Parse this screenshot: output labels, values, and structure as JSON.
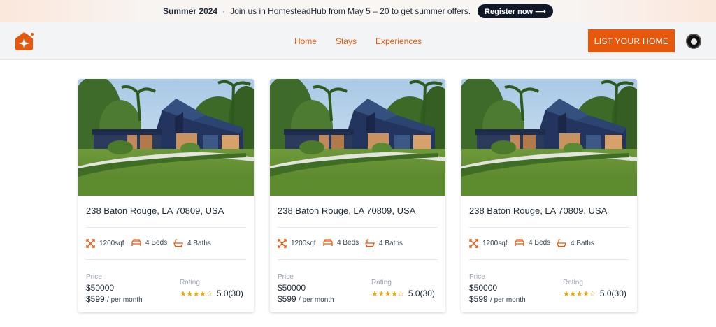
{
  "banner": {
    "season": "Summer 2024",
    "separator": "·",
    "message": "Join us in HomesteadHub from May 5 – 20 to get summer offers.",
    "cta_label": "Register now ⟶"
  },
  "nav": {
    "links": [
      "Home",
      "Stays",
      "Experiences"
    ],
    "cta_label": "LIST YOUR HOME"
  },
  "brand": {
    "accent": "#e8580c",
    "dark": "#111827",
    "star": "#e5a511"
  },
  "icons": {
    "logo": "house-star-icon",
    "area": "area-expand-icon",
    "beds": "bed-icon",
    "baths": "bathtub-icon",
    "star": "star-icon",
    "avatar": "user-avatar"
  },
  "listings": [
    {
      "address": "238 Baton Rouge, LA 70809, USA",
      "area": "1200sqf",
      "beds": "4 Beds",
      "baths": "4 Baths",
      "price_label": "Price",
      "price": "$50000",
      "monthly": "$599",
      "monthly_suffix": "/ per month",
      "rating_label": "Rating",
      "stars_full": 4,
      "stars_total": 5,
      "rating": "5.0(30)"
    },
    {
      "address": "238 Baton Rouge, LA 70809, USA",
      "area": "1200sqf",
      "beds": "4 Beds",
      "baths": "4 Baths",
      "price_label": "Price",
      "price": "$50000",
      "monthly": "$599",
      "monthly_suffix": "/ per month",
      "rating_label": "Rating",
      "stars_full": 4,
      "stars_total": 5,
      "rating": "5.0(30)"
    },
    {
      "address": "238 Baton Rouge, LA 70809, USA",
      "area": "1200sqf",
      "beds": "4 Beds",
      "baths": "4 Baths",
      "price_label": "Price",
      "price": "$50000",
      "monthly": "$599",
      "monthly_suffix": "/ per month",
      "rating_label": "Rating",
      "stars_full": 4,
      "stars_total": 5,
      "rating": "5.0(30)"
    }
  ]
}
